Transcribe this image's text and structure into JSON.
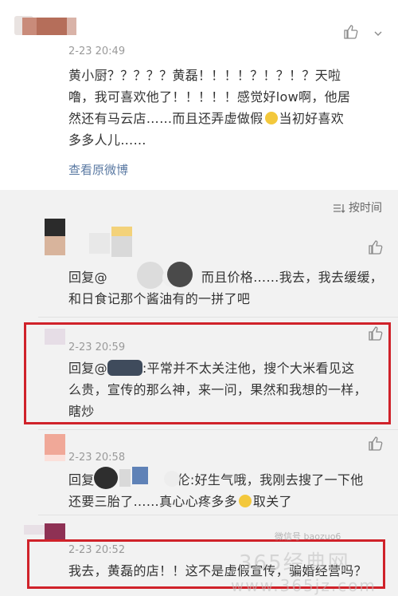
{
  "main_comment": {
    "time": "2-23 20:49",
    "lines": [
      "黄小厨？？？？？黄磊！！！！？！？！？天啦",
      "噜，我可喜欢他了！！！！！感觉好low啊，他居",
      "然还有马云店……而且还弄虚做假",
      "多多人儿……"
    ],
    "line3_tail": "当初好喜欢",
    "view_original": "查看原微博"
  },
  "sort_label": "按时间",
  "replies": [
    {
      "time": "",
      "lines": [
        "回复@",
        "而且价格……我去，我去缓缓，",
        "和日食记那个酱油有的一拼了吧"
      ]
    },
    {
      "time": "2-23 20:59",
      "lines": [
        "回复@",
        ":平常并不太关注他，搜个大米看见这",
        "么贵，宣传的那么神，来一问，果然和我想的一样，",
        "瞎炒"
      ]
    },
    {
      "time": "2-23 20:58",
      "lines": [
        "回复",
        "伦:好生气哦，我刚去搜了一下他",
        "还要三胎了……真心心疼多多",
        "取关了"
      ]
    },
    {
      "time": "2-23 20:52",
      "lines": [
        "我去，黄磊的店！！这不是虚假宣传，骗婚经营吗？"
      ]
    }
  ],
  "watermark": {
    "account": "微信号 baozuo6",
    "site": "365经典网",
    "url": "www.365jz.com"
  },
  "colors": {
    "highlight": "#d0222a",
    "link": "#5b7aa3",
    "timestamp": "#9a9a9a",
    "sub_background": "#f2f2f2"
  }
}
